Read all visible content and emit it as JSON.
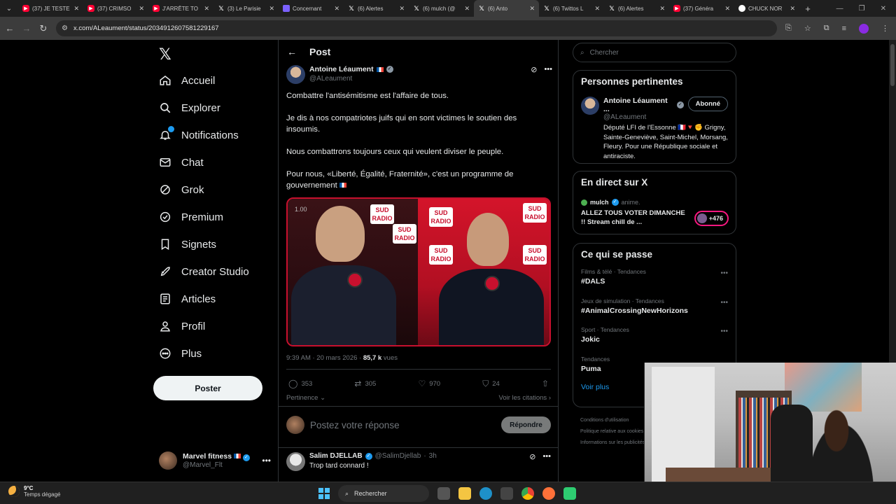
{
  "browser": {
    "tabs": [
      {
        "icon": "youtube",
        "label": "(37) JE TESTE"
      },
      {
        "icon": "youtube",
        "label": "(37) CRIMSO"
      },
      {
        "icon": "youtube",
        "label": "J'ARRÊTE TO"
      },
      {
        "icon": "x",
        "label": "(3) Le Parisie"
      },
      {
        "icon": "purple",
        "label": "Concernant"
      },
      {
        "icon": "x",
        "label": "(6) Alertes"
      },
      {
        "icon": "x",
        "label": "(6) mulch (@"
      },
      {
        "icon": "x",
        "label": "(6) Anto"
      },
      {
        "icon": "x",
        "label": "(6) Twittos L"
      },
      {
        "icon": "x",
        "label": "(6) Alertes"
      },
      {
        "icon": "youtube",
        "label": "(37) Généra"
      },
      {
        "icon": "google",
        "label": "CHUCK NOR"
      }
    ],
    "active_tab_index": 7,
    "url": "x.com/ALeaument/status/2034912607581229167"
  },
  "nav": {
    "items": [
      {
        "label": "Accueil",
        "icon": "home-icon"
      },
      {
        "label": "Explorer",
        "icon": "search-icon"
      },
      {
        "label": "Notifications",
        "icon": "bell-icon"
      },
      {
        "label": "Chat",
        "icon": "mail-icon"
      },
      {
        "label": "Grok",
        "icon": "grok-icon"
      },
      {
        "label": "Premium",
        "icon": "premium-icon"
      },
      {
        "label": "Signets",
        "icon": "bookmark-icon"
      },
      {
        "label": "Creator Studio",
        "icon": "rocket-icon"
      },
      {
        "label": "Articles",
        "icon": "article-icon"
      },
      {
        "label": "Profil",
        "icon": "person-icon"
      },
      {
        "label": "Plus",
        "icon": "more-icon"
      }
    ],
    "post_button": "Poster",
    "account": {
      "name": "Marvel fitness",
      "handle": "@Marvel_Flt"
    }
  },
  "post": {
    "header": "Post",
    "author_name": "Antoine Léaument",
    "author_handle": "@ALeaument",
    "text": [
      "Combattre l'antisémitisme est l'affaire de tous.",
      "Je dis à nos compatriotes juifs qui en sont victimes le soutien des insoumis.",
      "Nous combattrons toujours ceux qui veulent diviser le peuple.",
      "Pour nous, «Liberté, Égalité, Fraternité», c'est un programme de gouvernement"
    ],
    "media": {
      "time": "1.00",
      "logo": "SUD RADIO"
    },
    "time": "9:39 AM · 20 mars 2026 · ",
    "views": "85,7 k",
    "views_label": " vues",
    "stats": {
      "replies": "353",
      "reposts": "305",
      "likes": "970",
      "bookmarks": "24"
    },
    "sort_label": "Pertinence",
    "quotes_label": "Voir les citations",
    "reply_placeholder": "Postez votre réponse",
    "reply_button": "Répondre",
    "first_reply": {
      "name": "Salim DJELLAB",
      "handle": "@SalimDjellab",
      "time": "3h",
      "text": "Trop tard connard !"
    }
  },
  "sidebar": {
    "search_placeholder": "Chercher",
    "people": {
      "title": "Personnes pertinentes",
      "name": "Antoine Léaument ...",
      "handle": "@ALeaument",
      "follow_label": "Abonné",
      "bio": "Député LFI de l'Essonne 🇫🇷🔻✊ Grigny, Sainte-Geneviève, Saint-Michel, Morsang, Fleury. Pour une République sociale et antiraciste."
    },
    "live": {
      "title": "En direct sur X",
      "host": "mulch",
      "status": "anime.",
      "text": "ALLEZ TOUS VOTER DIMANCHE !! Stream chill de ...",
      "count": "+476"
    },
    "trends": {
      "title": "Ce qui se passe",
      "items": [
        {
          "category": "Films & télé · Tendances",
          "name": "#DALS"
        },
        {
          "category": "Jeux de simulation · Tendances",
          "name": "#AnimalCrossingNewHorizons"
        },
        {
          "category": "Sport · Tendances",
          "name": "Jokic"
        },
        {
          "category": "Tendances",
          "name": "Puma"
        }
      ],
      "show_more": "Voir plus"
    },
    "footer": [
      "Conditions d'utilisation",
      "Politique relative aux cookies",
      "Informations sur les publicités"
    ]
  },
  "taskbar": {
    "temperature": "9°C",
    "weather": "Temps dégagé",
    "search": "Rechercher"
  },
  "colors": {
    "accent": "#1d9bf0",
    "background": "#000000",
    "border": "#2f3336",
    "muted": "#71767b",
    "live_ring": "#f91880"
  }
}
